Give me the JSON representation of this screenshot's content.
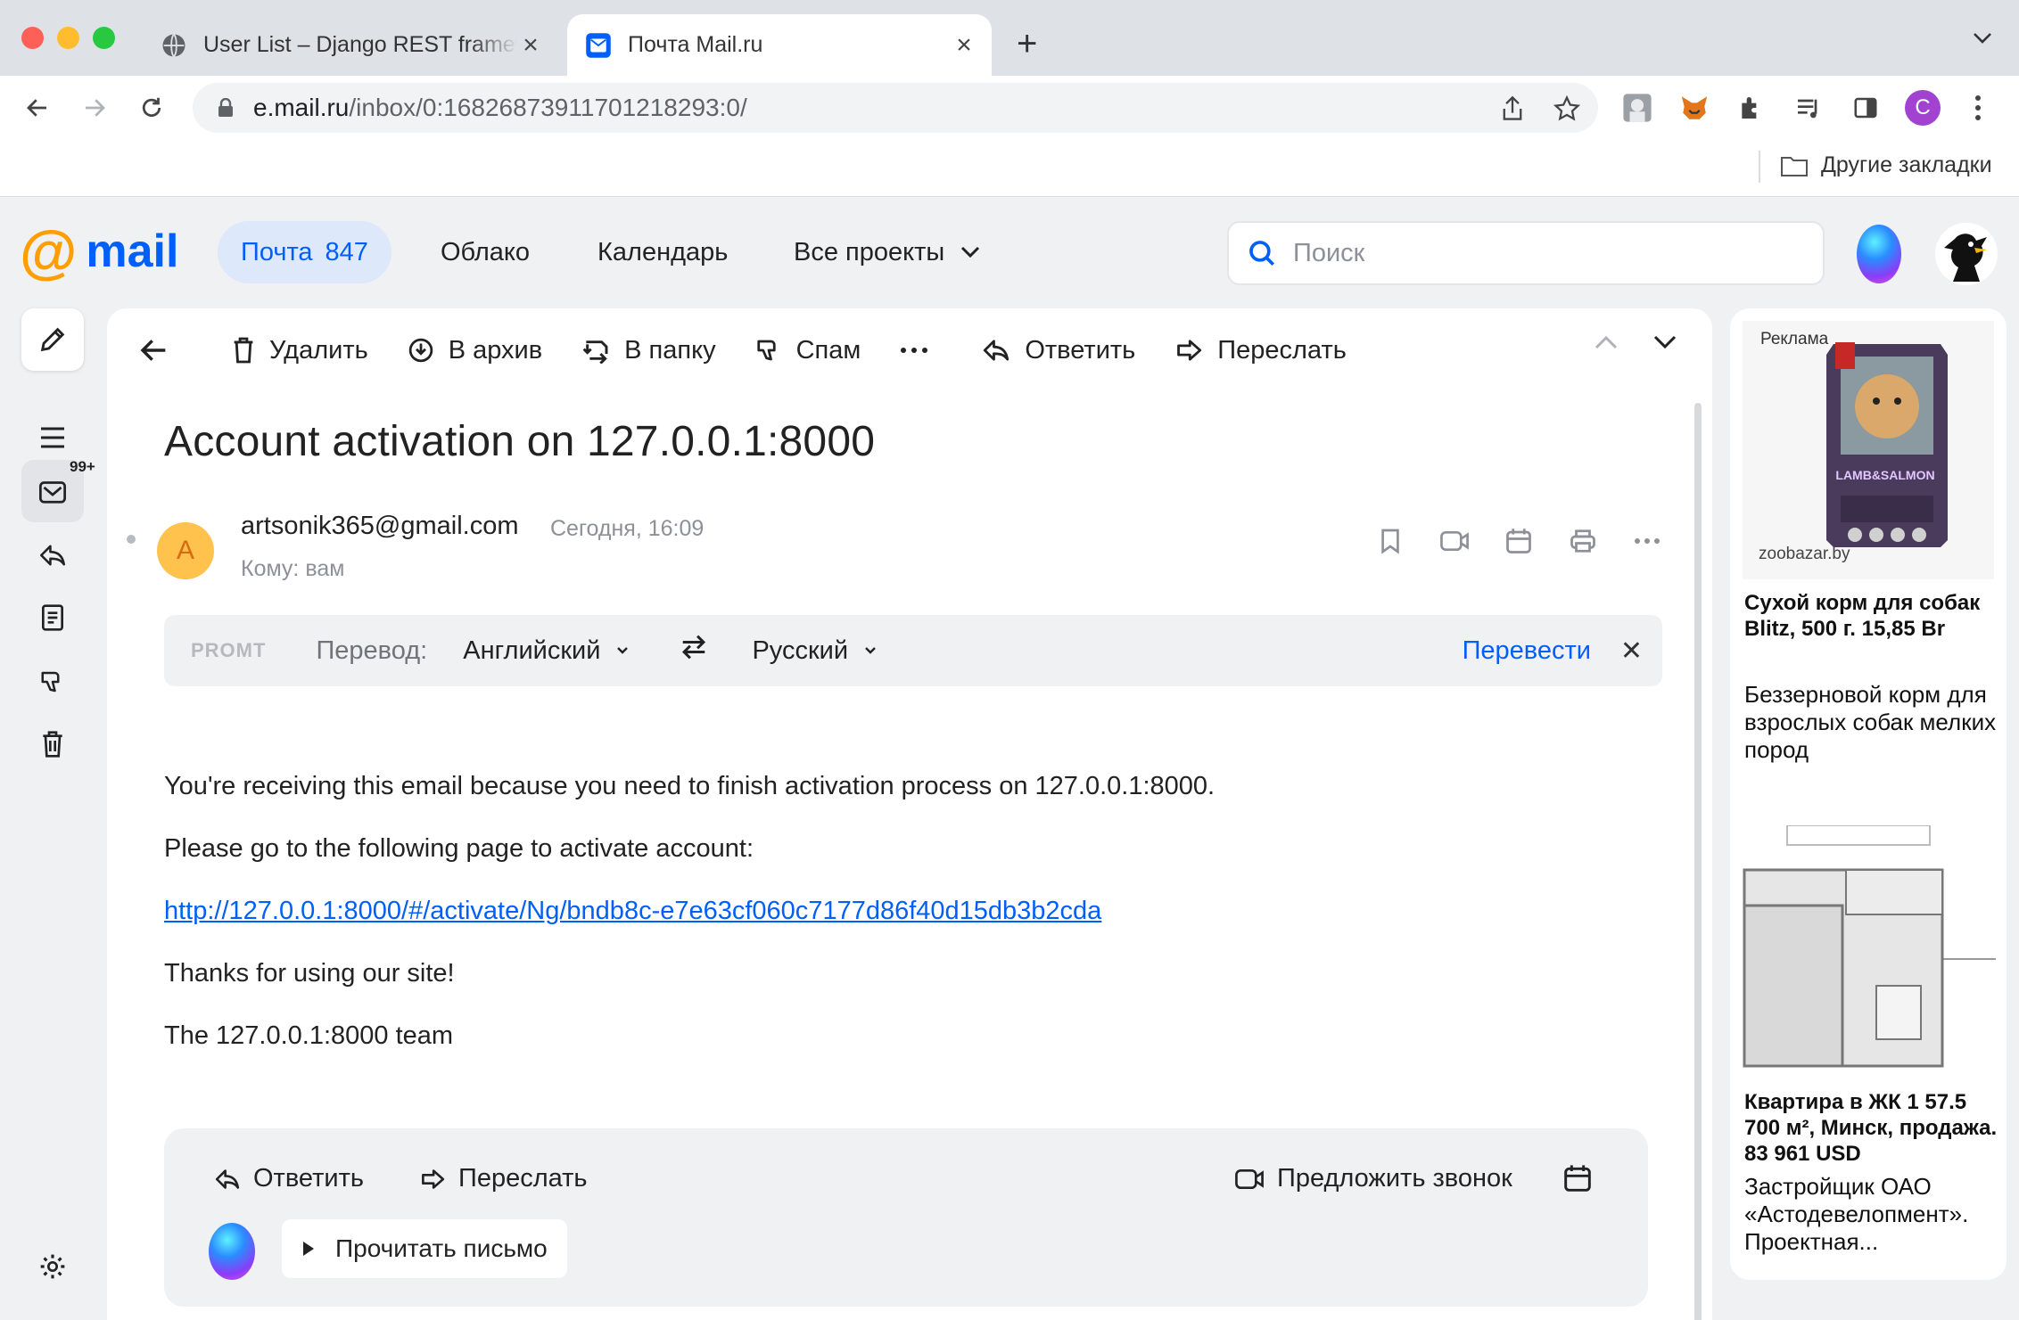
{
  "browser": {
    "tabs": [
      {
        "title": "User List – Django REST framework",
        "active": false
      },
      {
        "title": "Почта Mail.ru",
        "active": true
      }
    ],
    "url_host": "e.mail.ru",
    "url_path": "/inbox/0:16826873911701218293:0/",
    "profile_initial": "C",
    "bookmarks_other": "Другие закладки"
  },
  "header": {
    "logo_at": "@",
    "logo_word": "mail",
    "nav": {
      "mail_label": "Почта",
      "mail_count": "847",
      "cloud": "Облако",
      "calendar": "Календарь",
      "all_projects": "Все проекты"
    },
    "search_placeholder": "Поиск"
  },
  "rail": {
    "inbox_badge": "99+"
  },
  "toolbar": {
    "delete": "Удалить",
    "archive": "В архив",
    "to_folder": "В папку",
    "spam": "Спам",
    "reply": "Ответить",
    "forward": "Переслать"
  },
  "message": {
    "subject": "Account activation on 127.0.0.1:8000",
    "sender_initial": "A",
    "sender": "artsonik365@gmail.com",
    "date": "Сегодня, 16:09",
    "recipient": "Кому: вам",
    "body": {
      "line1": "You're receiving this email because you need to finish activation process on 127.0.0.1:8000.",
      "line2": "Please go to the following page to activate account:",
      "link": "http://127.0.0.1:8000/#/activate/Ng/bndb8c-e7e63cf060c7177d86f40d15db3b2cda",
      "line3": "Thanks for using our site!",
      "line4": "The 127.0.0.1:8000 team"
    }
  },
  "translate": {
    "brand": "PROMT",
    "label": "Перевод:",
    "source_lang": "Английский",
    "target_lang": "Русский",
    "action": "Перевести"
  },
  "replybox": {
    "reply": "Ответить",
    "forward": "Переслать",
    "suggest_call": "Предложить звонок",
    "read_aloud": "Прочитать письмо"
  },
  "ads": {
    "label": "Реклама",
    "ad1": {
      "site": "zoobazar.by",
      "title": "Сухой корм для собак Blitz, 500 г. 15,85 Br",
      "desc": "Беззерновой корм для взрослых собак мелких пород",
      "image_text": "LAMB&SALMON"
    },
    "ad2": {
      "title": "Квартира в ЖК 1 57.5 700 м², Минск, продажа. 83 961 USD",
      "desc": "Застройщик ОАО «Астодевелопмент». Проектная..."
    }
  }
}
